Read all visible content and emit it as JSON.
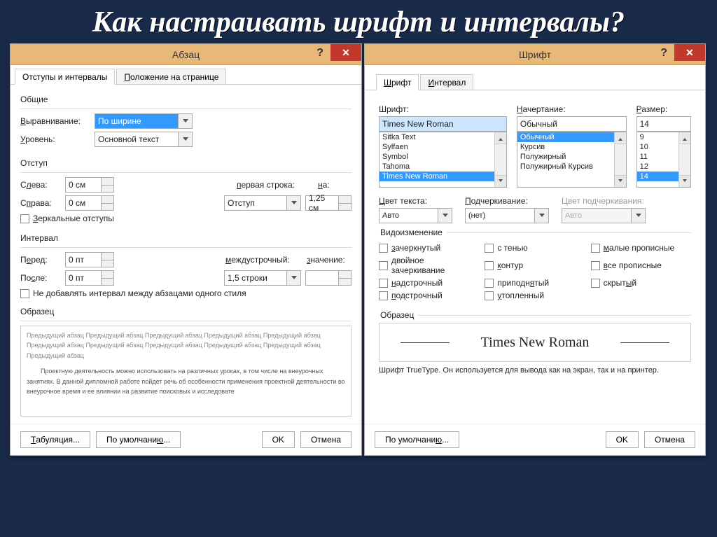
{
  "slide_title": "Как настраивать шрифт и интервалы?",
  "paragraph": {
    "title": "Абзац",
    "tabs": {
      "indents": "Отступы и интервалы",
      "position_u": "П",
      "position_rest": "оложение на странице"
    },
    "general": "Общие",
    "alignment_u": "В",
    "alignment_rest": "ыравнивание:",
    "alignment_val": "По ширине",
    "level_u": "У",
    "level_rest": "ровень:",
    "level_val": "Основной текст",
    "indent": "Отступ",
    "left_u": "л",
    "left_pre": "С",
    "left_rest": "ева:",
    "left_val": "0 см",
    "right_u": "п",
    "right_pre": "С",
    "right_rest": "рава:",
    "right_val": "0 см",
    "firstline_u": "п",
    "firstline_rest": "ервая строка:",
    "firstline_val": "Отступ",
    "by_u": "н",
    "by_rest": "а:",
    "by_val": "1,25 см",
    "mirror_u": "З",
    "mirror_rest": "еркальные отступы",
    "spacing": "Интервал",
    "before_u": "е",
    "before_pre": "П",
    "before_rest": "ред:",
    "before_val": "0 пт",
    "after_u": "с",
    "after_pre": "По",
    "after_rest": "ле:",
    "after_val": "0 пт",
    "linesp_u": "м",
    "linesp_rest": "еждустрочный:",
    "linesp_val": "1,5 строки",
    "atval_u": "з",
    "atval_rest": "начение:",
    "atval_val": "",
    "dontadd": "Не добавлять интервал между абзацами одного стиля",
    "sample": "Образец",
    "sample_text": "Предыдущий абзац Предыдущий абзац Предыдущий абзац Предыдущий абзац Предыдущий абзац Предыдущий абзац Предыдущий абзац Предыдущий абзац Предыдущий абзац Предыдущий абзац Предыдущий абзац",
    "sample_text2": "Проектную деятельность можно использовать на различных уроках, в том числе на внеурочных занятиях. В данной дипломной работе пойдет речь об особенности применения проектной деятельности во внеурочное время и ее влиянии на развитие поисковых и исследовате",
    "tabs_btn_u": "Т",
    "tabs_btn_rest": "абуляция...",
    "default_btn_pre": "По умолчани",
    "default_btn_u": "ю",
    "default_btn_rest": "...",
    "ok": "OK",
    "cancel": "Отмена"
  },
  "font": {
    "title": "Шрифт",
    "tabs": {
      "font_u": "Ш",
      "font_rest": "рифт",
      "interval_u": "И",
      "interval_rest": "нтервал"
    },
    "font_label": "Шрифт:",
    "font_val": "Times New Roman",
    "font_list": [
      "Sitka Text",
      "Sylfaen",
      "Symbol",
      "Tahoma",
      "Times New Roman"
    ],
    "font_sel": "Times New Roman",
    "style_u": "Н",
    "style_rest": "ачертание:",
    "style_val": "Обычный",
    "style_list": [
      "Обычный",
      "Курсив",
      "Полужирный",
      "Полужирный Курсив"
    ],
    "style_sel": "Обычный",
    "size_u": "Р",
    "size_rest": "азмер:",
    "size_val": "14",
    "size_list": [
      "9",
      "10",
      "11",
      "12",
      "14"
    ],
    "size_sel": "14",
    "color_u": "Ц",
    "color_rest": "вет текста:",
    "color_val": "Авто",
    "under_u": "П",
    "under_rest": "одчеркивание:",
    "under_val": "(нет)",
    "ucolor": "Цвет подчеркивания:",
    "ucolor_val": "Авто",
    "effects_title": "Видоизменение",
    "effects": {
      "strike_u": "з",
      "strike_rest": "ачеркнутый",
      "shadow": "с тенью",
      "smallcaps_u": "м",
      "smallcaps_rest": "алые прописные",
      "dstrike_u": "д",
      "dstrike_rest": "войное зачеркивание",
      "outline_u": "к",
      "outline_rest": "онтур",
      "allcaps_u": "в",
      "allcaps_rest": "се прописные",
      "super_u": "н",
      "super_rest": "адстрочный",
      "emboss_u": "я",
      "emboss_pre": "приподн",
      "emboss_rest": "тый",
      "hidden_u": "ы",
      "hidden_pre": "скрыт",
      "hidden_rest": "й",
      "sub_u": "п",
      "sub_rest": "одстрочный",
      "engrave_u": "у",
      "engrave_rest": "топленный"
    },
    "sample": "Образец",
    "sample_font": "Times New Roman",
    "truetype": "Шрифт TrueType. Он используется для вывода как на экран, так и на принтер.",
    "default_btn_pre": "По умолчани",
    "default_btn_u": "ю",
    "default_btn_rest": "...",
    "ok": "OK",
    "cancel": "Отмена"
  }
}
